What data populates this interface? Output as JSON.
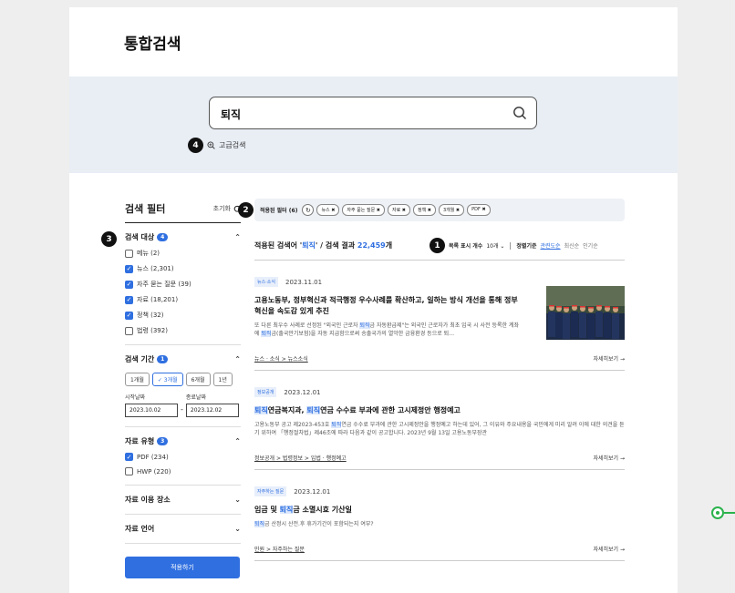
{
  "page": {
    "title": "통합검색"
  },
  "search": {
    "value": "퇴직",
    "advanced_label": "고급검색",
    "step": "4"
  },
  "sidebar": {
    "title": "검색 필터",
    "reset_label": "초기화",
    "step": "3",
    "target": {
      "label": "검색 대상",
      "badge": "4",
      "options": [
        {
          "label": "메뉴 (2)",
          "checked": false
        },
        {
          "label": "뉴스 (2,301)",
          "checked": true
        },
        {
          "label": "자주 묻는 질문 (39)",
          "checked": true
        },
        {
          "label": "자료 (18,201)",
          "checked": true
        },
        {
          "label": "정책 (32)",
          "checked": true
        },
        {
          "label": "법령 (392)",
          "checked": false
        }
      ]
    },
    "period": {
      "label": "검색 기간",
      "badge": "1",
      "options": [
        "1개월",
        "3개월",
        "6개월",
        "1년"
      ],
      "selected": "3개월",
      "start_label": "시작날짜",
      "start_value": "2023.10.02",
      "end_label": "종료날짜",
      "end_value": "2023.12.02"
    },
    "type": {
      "label": "자료 유형",
      "badge": "3",
      "options": [
        {
          "label": "PDF (234)",
          "checked": true
        },
        {
          "label": "HWP (220)",
          "checked": false
        }
      ]
    },
    "usage_label": "자료 이용 장소",
    "language_label": "자료 언어",
    "apply_label": "적용하기"
  },
  "filters": {
    "step": "2",
    "label": "적용된 필터 (6)",
    "chips": [
      "뉴스",
      "자주 묻는 질문",
      "자료",
      "정책",
      "3개월",
      "PDF"
    ]
  },
  "results": {
    "prefix": "적용된 검색어 '",
    "keyword": "퇴직",
    "middle": "' / 검색 결과 ",
    "count": "22,459",
    "suffix": "개",
    "step": "1",
    "per_page_label": "목록 표시 개수",
    "per_page_value": "10개",
    "sort_label": "정렬기준",
    "sort_options": [
      "관련도순",
      "최신순",
      "인기순"
    ],
    "sort_selected": "관련도순",
    "more_label": "자세히보기 →",
    "items": [
      {
        "tag": "뉴스·소식",
        "date": "2023.11.01",
        "title": "고용노동부, 정부혁신과 적극행정 우수사례를 확산하고, 일하는 방식 개선을 통해 정부혁신을 속도감 있게 추진",
        "body": "또 다른 최우수 사례로 선정된 \"외국인 근로자 퇴직금 자동환급제\"는 외국인 근로자가 최초 입국 시 사전 등록한 계좌에 퇴직금(출국만기보험)을 자동 지급함으로써 송출국가의 열악한 금융환경 등으로 퇴…",
        "path": "뉴스 · 소식 > 뉴스소식"
      },
      {
        "tag": "정보공개",
        "date": "2023.12.01",
        "title": "퇴직연금복지과, 퇴직연금 수수료 부과에 관한 고시제정안 행정예고",
        "body": "고용노동부 공고 제2023-453호 퇴직연금 수수료 부과에 관한 고시제정안을 행정예고 하는데 있어, 그 이유와 주요내용을 국민에게 미리 알려 이에 대한 의견을 듣기 위하여 「행정절차법」제46조에 따라 다음과 같이 공고합니다. 2023년 9월 13일 고용노동부장관",
        "path": "정보공개 > 법령정보 > 입법 · 행정예고"
      },
      {
        "tag": "자주하는 질문",
        "date": "2023.12.01",
        "title": "임금 및 퇴직금 소멸시효 기산일",
        "body": "퇴직금 산정시 산전.후 휴가기간이 포함되는지 여부?",
        "path": "민원 > 자주하는 질문"
      }
    ]
  },
  "colors": {
    "accent": "#2f6fe0",
    "band": "#e9eef5",
    "connector": "#2bb24c"
  }
}
